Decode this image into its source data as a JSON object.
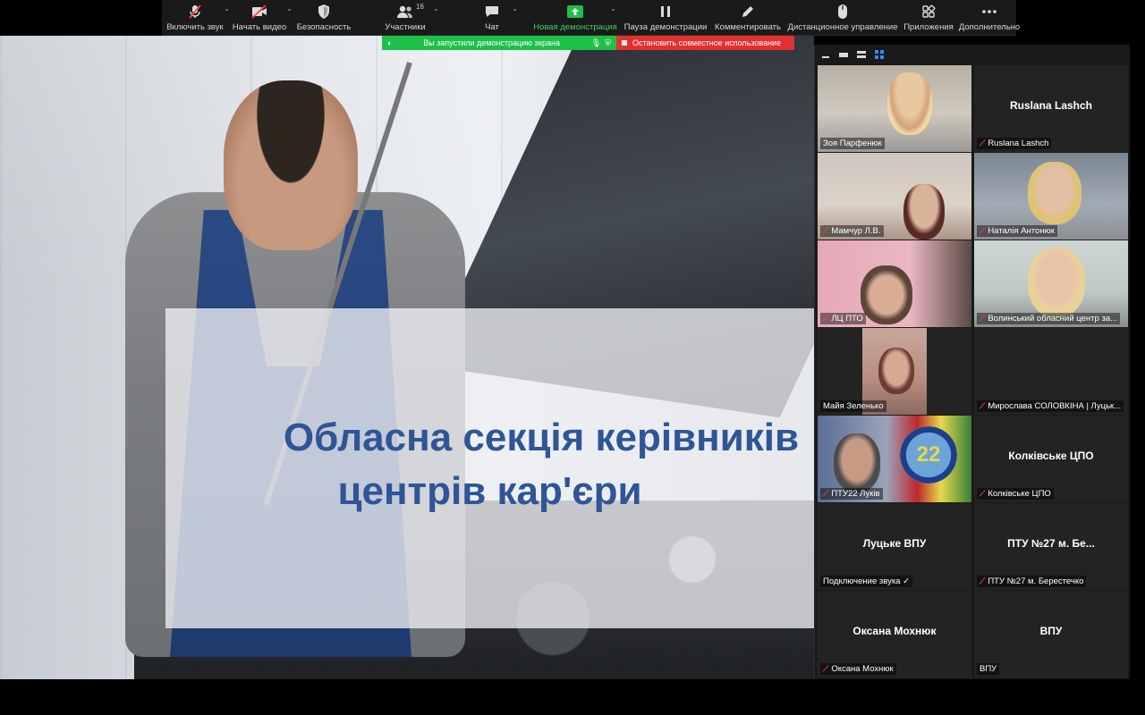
{
  "toolbar": {
    "items": [
      {
        "label": "Включить звук",
        "icon": "microphone-muted-icon",
        "caret": "⌄"
      },
      {
        "label": "Начать видео",
        "icon": "video-off-icon",
        "caret": "⌄"
      },
      {
        "label": "Безопасность",
        "icon": "shield-icon"
      },
      {
        "label": "Участники",
        "icon": "participants-icon",
        "badge": "16",
        "caret": "⌄"
      },
      {
        "label": "Чат",
        "icon": "chat-icon",
        "caret": "⌄"
      },
      {
        "label": "Новая демонстрация",
        "icon": "share-screen-icon",
        "caret": "⌄"
      },
      {
        "label": "Пауза демонстрации",
        "icon": "pause-icon"
      },
      {
        "label": "Комментировать",
        "icon": "pencil-icon"
      },
      {
        "label": "Дистанционное управление",
        "icon": "mouse-icon"
      },
      {
        "label": "Приложения",
        "icon": "apps-icon"
      },
      {
        "label": "Дополнительно",
        "icon": "more-icon"
      }
    ]
  },
  "banner": {
    "sharing_text": "Вы запустили демонстрацию экрана",
    "stop_text": "Остановить совместное использование"
  },
  "slide": {
    "line1": "Обласна секція керівників",
    "line2": "центрів кар'єри"
  },
  "gallery": {
    "tiles": [
      {
        "name": "Зоя Парфенюк",
        "center": "",
        "video": "v1",
        "muted": false,
        "active": true
      },
      {
        "name": "Ruslana Lashch",
        "center": "Ruslana Lashch",
        "video": "",
        "muted": true
      },
      {
        "name": "Мамчур Л.В.",
        "center": "",
        "video": "v2",
        "muted": true
      },
      {
        "name": "Наталія Антонюк",
        "center": "",
        "video": "v3",
        "muted": true
      },
      {
        "name": "ЛЦ ПТО",
        "center": "",
        "video": "v4",
        "muted": true
      },
      {
        "name": "Волинський обласний центр за...",
        "center": "",
        "video": "v5",
        "muted": true
      },
      {
        "name": "Майя Зеленько",
        "center": "",
        "video": "v6",
        "muted": false
      },
      {
        "name": "Мирослава СОЛОВКІНА | Луцьк...",
        "center": "",
        "video": "",
        "muted": true
      },
      {
        "name": "ПТУ22 Луків",
        "center": "",
        "video": "v7",
        "muted": true,
        "logo": "22"
      },
      {
        "name": "Колківське ЦПО",
        "center": "Колківське ЦПО",
        "video": "",
        "muted": true
      },
      {
        "name": "Подключение звука ✓",
        "center": "Луцьке ВПУ",
        "video": "",
        "muted": false
      },
      {
        "name": "ПТУ №27 м. Берестечко",
        "center": "ПТУ №27 м. Бе...",
        "video": "",
        "muted": true
      },
      {
        "name": "Оксана Мохнюк",
        "center": "Оксана Мохнюк",
        "video": "",
        "muted": true
      },
      {
        "name": "ВПУ",
        "center": "ВПУ",
        "video": "",
        "muted": false
      }
    ]
  },
  "colors": {
    "toolbar_bg": "#1a1a1a",
    "share_green": "#1ec04a",
    "stop_red": "#e22f2f",
    "title_blue": "#2f5597",
    "mute_red": "#ff4343"
  }
}
